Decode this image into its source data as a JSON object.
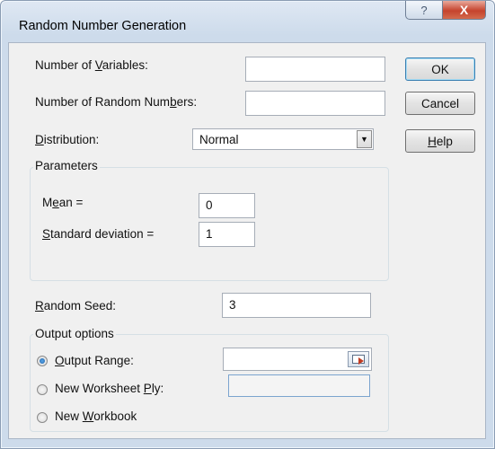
{
  "window": {
    "title": "Random Number Generation",
    "help_glyph": "?",
    "close_glyph": "X"
  },
  "fields": {
    "num_variables": {
      "label_pre": "Number of ",
      "label_key": "V",
      "label_post": "ariables:",
      "value": ""
    },
    "num_random": {
      "label_pre": "Number of Random Num",
      "label_key": "b",
      "label_post": "ers:",
      "value": ""
    },
    "distribution": {
      "label_pre": "",
      "label_key": "D",
      "label_post": "istribution:",
      "value": "Normal"
    },
    "random_seed": {
      "label_pre": "",
      "label_key": "R",
      "label_post": "andom Seed:",
      "value": "3"
    }
  },
  "buttons": {
    "ok": "OK",
    "cancel": "Cancel",
    "help_pre": "",
    "help_key": "H",
    "help_post": "elp"
  },
  "parameters": {
    "title": "Parameters",
    "mean": {
      "label_pre": "M",
      "label_key": "e",
      "label_post": "an =",
      "value": "0"
    },
    "std": {
      "label_pre": "",
      "label_key": "S",
      "label_post": "tandard deviation =",
      "value": "1"
    }
  },
  "output": {
    "title": "Output options",
    "output_range": {
      "label_pre": "",
      "label_key": "O",
      "label_post": "utput Range:",
      "value": "",
      "checked": true
    },
    "new_ply": {
      "label_pre": "New Worksheet ",
      "label_key": "P",
      "label_post": "ly:",
      "value": "",
      "checked": false
    },
    "new_workbook": {
      "label_pre": "New ",
      "label_key": "W",
      "label_post": "orkbook",
      "checked": false
    }
  },
  "icons": {
    "dropdown": "chevron-down-icon",
    "range_selector": "range-select-icon"
  }
}
